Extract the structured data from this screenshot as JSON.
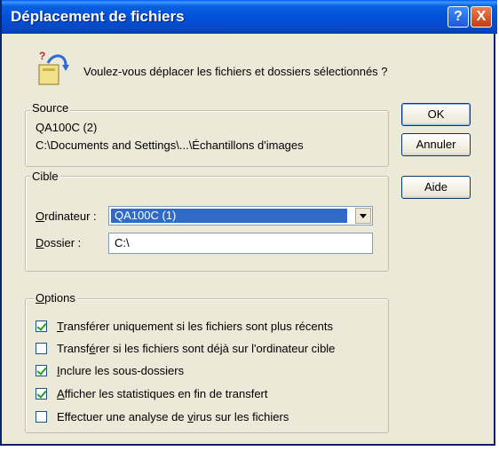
{
  "window": {
    "title": "Déplacement de fichiers"
  },
  "titlebar": {
    "help_label": "?",
    "close_label": "X"
  },
  "message": {
    "icon": "move-files-icon",
    "text": "Voulez-vous déplacer les fichiers et dossiers sélectionnés ?"
  },
  "source": {
    "legend": "Source",
    "computer": "QA100C (2)",
    "path": "C:\\Documents and Settings\\...\\Échantillons d'images"
  },
  "target": {
    "legend": "Cible",
    "computer_label_accel": "O",
    "computer_label_rest": "rdinateur :",
    "computer_value": "QA100C (1)",
    "folder_label_accel": "D",
    "folder_label_rest": "ossier :",
    "folder_value": "C:\\"
  },
  "options": {
    "legend_accel": "O",
    "legend_rest": "ptions",
    "items": [
      {
        "checked": true,
        "pre": "",
        "accel": "T",
        "post": "ransférer uniquement si les fichiers sont plus récents"
      },
      {
        "checked": false,
        "pre": "Transf",
        "accel": "é",
        "post": "rer si les fichiers sont déjà sur l'ordinateur cible"
      },
      {
        "checked": true,
        "pre": "",
        "accel": "I",
        "post": "nclure les sous-dossiers"
      },
      {
        "checked": true,
        "pre": "",
        "accel": "A",
        "post": "fficher les statistiques en fin de transfert"
      },
      {
        "checked": false,
        "pre": "Effectuer une analyse de ",
        "accel": "v",
        "post": "irus sur les fichiers"
      }
    ]
  },
  "buttons": {
    "ok": "OK",
    "cancel": "Annuler",
    "help": "Aide"
  }
}
